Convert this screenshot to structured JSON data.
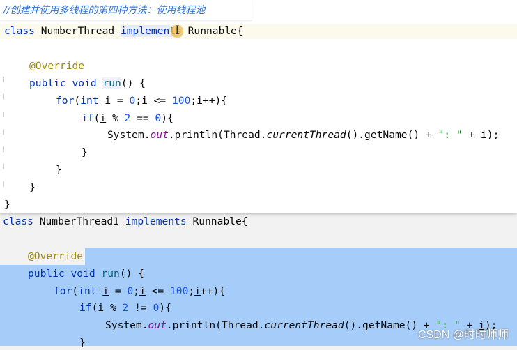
{
  "comment": "//创建并使用多线程的第四种方法：使用线程池",
  "top_code": {
    "l1": {
      "kw": "class",
      "name": "NumberThread",
      "impl": "implements",
      "iface": "Runnable{"
    },
    "l2": "@Override",
    "l3": {
      "kw": "public void",
      "name": "run",
      "rest": "() {"
    },
    "l4": {
      "kw": "for",
      "a": "(",
      "t": "int",
      "i1": "i",
      "eq": " = ",
      "n0": "0",
      "sc": ";",
      "i2": "i",
      "lt": " <= ",
      "n100": "100",
      "sc2": ";",
      "i3": "i",
      "inc": "++){"
    },
    "l5": {
      "kw": "if",
      "a": "(",
      "i": "i",
      "mod": " % ",
      "n2": "2",
      "eq": " == ",
      "n0": "0",
      "b": "){"
    },
    "l6": {
      "sys": "System.",
      "out": "out",
      "pl": ".println(Thread.",
      "ct": "currentThread",
      "gn": "().getName() + ",
      "str": "\": \"",
      "plus": " + ",
      "i": "i",
      "end": ");"
    },
    "l7": "}",
    "l8": "}",
    "l9": "}",
    "l10": "}"
  },
  "bottom_code": {
    "l1": {
      "kw": "class",
      "name": "NumberThread1",
      "impl": "implements",
      "iface": "Runnable{"
    },
    "l2": "@Override",
    "l3": {
      "kw": "public void",
      "name": "run",
      "rest": "() {"
    },
    "l4": {
      "kw": "for",
      "a": "(",
      "t": "int",
      "i1": "i",
      "eq": " = ",
      "n0": "0",
      "sc": ";",
      "i2": "i",
      "lt": " <= ",
      "n100": "100",
      "sc2": ";",
      "i3": "i",
      "inc": "++){"
    },
    "l5": {
      "kw": "if",
      "a": "(",
      "i": "i",
      "mod": " % ",
      "n2": "2",
      "ne": " != ",
      "n0": "0",
      "b": "){"
    },
    "l6": {
      "sys": "System.",
      "out": "out",
      "pl": ".println(Thread.",
      "ct": "currentThread",
      "gn": "().getName() + ",
      "str": "\": \"",
      "plus": " + ",
      "i": "i",
      "end": ");"
    },
    "l7": "}"
  },
  "watermark": "CSDN @时时师师"
}
